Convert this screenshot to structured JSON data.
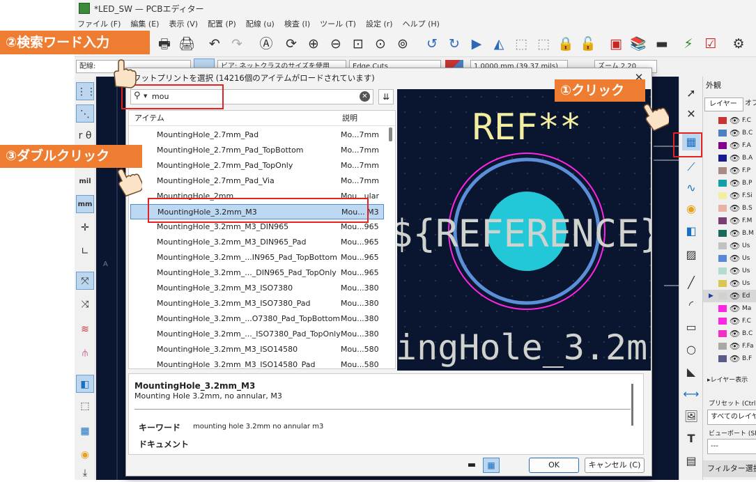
{
  "window": {
    "title": "*LED_SW — PCBエディター"
  },
  "menu": [
    "ファイル (F)",
    "編集 (E)",
    "表示 (V)",
    "配置 (P)",
    "配線 (u)",
    "検査 (I)",
    "ツール (T)",
    "設定 (r)",
    "ヘルプ (H)"
  ],
  "aux": {
    "track_label": "配線:",
    "via_combo": "ビア: ネットクラスのサイズを使用",
    "layer_combo": "Edge.Cuts",
    "grid_combo": "1.0000 mm (39.37 mils)",
    "zoom_combo": "ズーム 2.20"
  },
  "left_tools": {
    "mil": "mil",
    "mm": "mm"
  },
  "dialog": {
    "title": "フットプリントを選択 (14216個のアイテムがロードされています)",
    "search": {
      "value": "mou"
    },
    "list": {
      "headers": {
        "item": "アイテム",
        "desc": "説明"
      },
      "rows": [
        {
          "name": "MountingHole_2.7mm_Pad",
          "desc": "Mo...7mm"
        },
        {
          "name": "MountingHole_2.7mm_Pad_TopBottom",
          "desc": "Mo...7mm"
        },
        {
          "name": "MountingHole_2.7mm_Pad_TopOnly",
          "desc": "Mo...7mm"
        },
        {
          "name": "MountingHole_2.7mm_Pad_Via",
          "desc": "Mo...7mm"
        },
        {
          "name": "MountingHole_2mm",
          "desc": "Mou...ular"
        },
        {
          "name": "MountingHole_3.2mm_M3",
          "desc": "Mou... M3"
        },
        {
          "name": "MountingHole_3.2mm_M3_DIN965",
          "desc": "Mou...965"
        },
        {
          "name": "MountingHole_3.2mm_M3_DIN965_Pad",
          "desc": "Mou...965"
        },
        {
          "name": "MountingHole_3.2mm_...IN965_Pad_TopBottom",
          "desc": "Mou...965"
        },
        {
          "name": "MountingHole_3.2mm_..._DIN965_Pad_TopOnly",
          "desc": "Mou...965"
        },
        {
          "name": "MountingHole_3.2mm_M3_ISO7380",
          "desc": "Mou...380"
        },
        {
          "name": "MountingHole_3.2mm_M3_ISO7380_Pad",
          "desc": "Mou...380"
        },
        {
          "name": "MountingHole_3.2mm_...O7380_Pad_TopBottom",
          "desc": "Mou...380"
        },
        {
          "name": "MountingHole_3.2mm_..._ISO7380_Pad_TopOnly",
          "desc": "Mou...380"
        },
        {
          "name": "MountingHole_3.2mm_M3_ISO14580",
          "desc": "Mou...580"
        },
        {
          "name": "MountingHole_3.2mm_M3_ISO14580_Pad",
          "desc": "Mou...580"
        }
      ],
      "selected_index": 5
    },
    "preview": {
      "ref": "REF**",
      "value_text": "${REFERENCE}",
      "name_text": "ingHole_3.2m"
    },
    "details": {
      "name": "MountingHole_3.2mm_M3",
      "description": "Mounting Hole 3.2mm, no annular, M3",
      "keywords_label": "キーワード",
      "keywords": "mounting hole 3.2mm no annular m3",
      "doc_label": "ドキュメント"
    },
    "ok_label": "OK",
    "cancel_label": "キャンセル (C)"
  },
  "layers_panel": {
    "title": "外観",
    "tabs": [
      "レイヤー",
      "オブ"
    ],
    "layers": [
      {
        "name": "F.C",
        "color": "#c83434"
      },
      {
        "name": "B.C",
        "color": "#4d7fc4"
      },
      {
        "name": "F.A",
        "color": "#84008f"
      },
      {
        "name": "B.A",
        "color": "#1a1a8c"
      },
      {
        "name": "F.P",
        "color": "#a78c86"
      },
      {
        "name": "B.P",
        "color": "#11a0a8"
      },
      {
        "name": "F.Si",
        "color": "#f2eda1"
      },
      {
        "name": "B.S",
        "color": "#e8b2a7"
      },
      {
        "name": "F.M",
        "color": "#7a3e74"
      },
      {
        "name": "B.M",
        "color": "#1a6a5c"
      },
      {
        "name": "Us",
        "color": "#c2c2c2"
      },
      {
        "name": "Us",
        "color": "#5988d8"
      },
      {
        "name": "Us",
        "color": "#b2dcd2"
      },
      {
        "name": "Us",
        "color": "#d8c852"
      },
      {
        "name": "Ed",
        "color": "#d0d2cd"
      },
      {
        "name": "Ma",
        "color": "#ff26e2"
      },
      {
        "name": "F.C",
        "color": "#ff26e2"
      },
      {
        "name": "B.C",
        "color": "#f230c8"
      },
      {
        "name": "F.Fa",
        "color": "#a8a8a8"
      },
      {
        "name": "B.F",
        "color": "#5a5a8a"
      }
    ],
    "show_label": "レイヤー表示",
    "preset_label": "プリセット (Ctrl+",
    "preset_value": "すべてのレイヤ",
    "viewport_label": "ビューポート (Shif",
    "viewport_value": "---",
    "filter_label": "フィルター選択"
  },
  "annotations": {
    "step1": "①クリック",
    "step2": "②検索ワード入力",
    "step3": "③ダブルクリック"
  },
  "colors": {
    "accent": "#ee7d31",
    "highlight": "#e52222",
    "selection": "#bcd8f2",
    "pcb_bg": "#0a1530",
    "pad": "#22c8d8",
    "silk": "#f2eda1"
  }
}
